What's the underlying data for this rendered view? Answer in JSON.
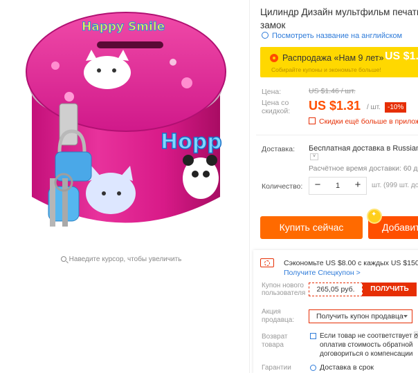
{
  "product": {
    "title_line1": "Цилиндр Дизайн мультфильм печати к",
    "title_line2": "замок",
    "translate_link": "Посмотреть название на английском",
    "image_alt": "Pink cylindrical tin coin bank with lock",
    "tin_text": "Happy Smile",
    "zoom_hint": "Наведите курсор, чтобы увеличить"
  },
  "sale": {
    "title": "Распродажа «Нам 9 лет»",
    "price": "US $1.",
    "subtitle": "Собирайте купоны и экономьте больше!"
  },
  "pricing": {
    "price_label": "Цена:",
    "old_price": "US $1.46 / шт.",
    "discount_price_label_line1": "Цена со",
    "discount_price_label_line2": "скидкой:",
    "new_price": "US $1.31",
    "per_unit": "/ шт.",
    "discount_badge": "-10%",
    "more_discounts": "Скидки ещё больше в прилож"
  },
  "shipping": {
    "label": "Доставка:",
    "value": "Бесплатная доставка в Russian",
    "select_icon": "chevron-down-icon",
    "estimate": "Расчётное время доставки: 60 дн"
  },
  "quantity": {
    "label": "Количество:",
    "value": "1",
    "minus": "−",
    "plus": "+",
    "available": "шт. (999 шт. досту"
  },
  "actions": {
    "buy_now": "Купить сейчас",
    "add_to_cart": "Добавить"
  },
  "coupons": {
    "save_text": "Сэкономьте US $8.00 с каждых US $150.00",
    "get_coupon_link": "Получите Спецкупон >",
    "new_user_label_line1": "Купон нового",
    "new_user_label_line2": "пользователя",
    "new_user_value": "265,05 руб.",
    "new_user_button": "ПОЛУЧИТЬ",
    "seller_label_line1": "Акция",
    "seller_label_line2": "продавца:",
    "seller_select": "Получить купон продавца",
    "return_label_line1": "Возврат",
    "return_label_line2": "товара",
    "return_text_line1": "Если товар не соответствует о",
    "return_text_line2": "оплатив стоимость обратной",
    "return_text_line3": "договориться о компенсации",
    "guarantee_label": "Гарантии",
    "guarantee_text": "Доставка в срок"
  },
  "colors": {
    "accent_orange": "#ff6a00",
    "price_red": "#ff4e00",
    "link_blue": "#2e7bd9",
    "sale_yellow": "#ffd800",
    "tin_pink": "#e4228f"
  }
}
